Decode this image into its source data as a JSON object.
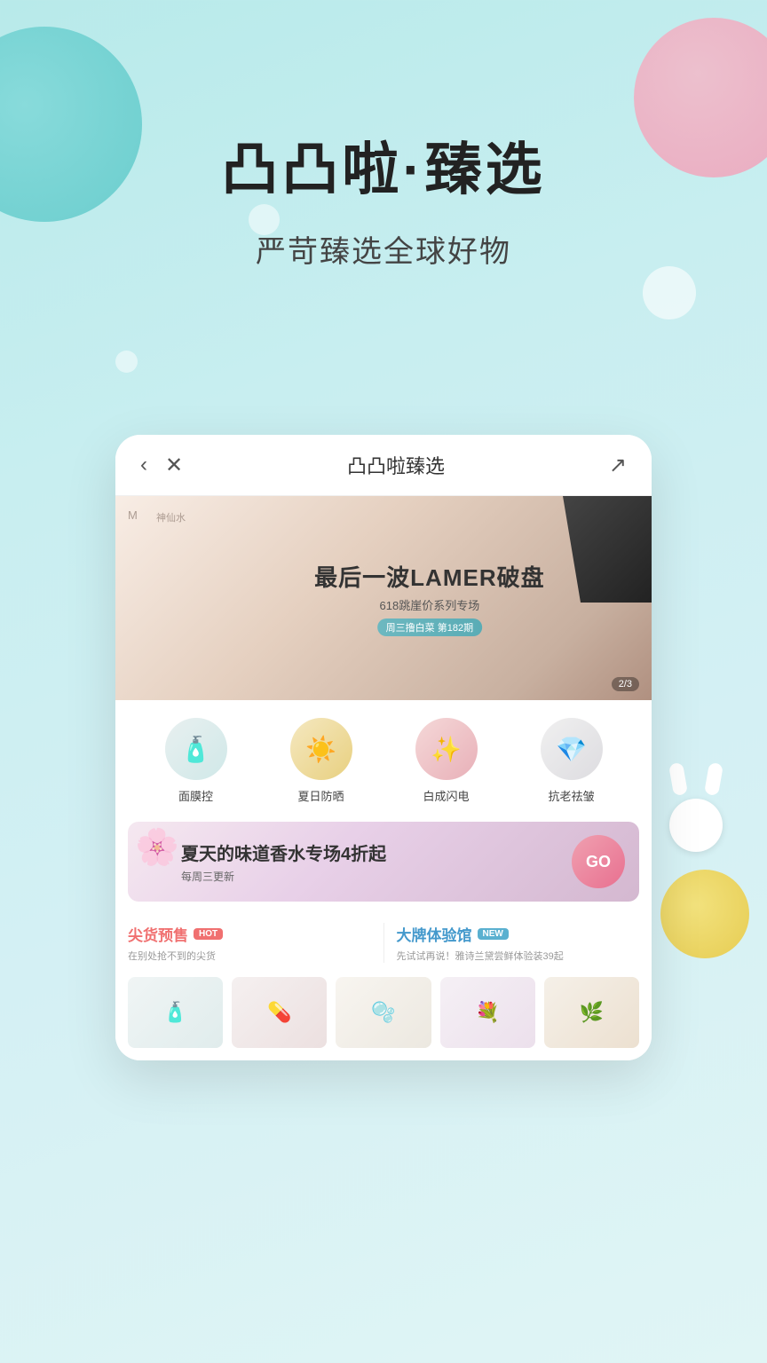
{
  "app": {
    "background_color": "#b8eaea"
  },
  "hero": {
    "title": "凸凸啦·臻选",
    "subtitle": "严苛臻选全球好物"
  },
  "phone_nav": {
    "title": "凸凸啦臻选",
    "back_label": "‹",
    "close_label": "✕",
    "share_label": "↗"
  },
  "banner": {
    "watermark": "M",
    "watermark2": "神仙水",
    "main_title": "最后一波LAMER破盘",
    "sub_title": "618跳崖价系列专场",
    "tag_label": "周三撸白菜 第182期",
    "indicator": "2/3"
  },
  "categories": [
    {
      "label": "面膜控",
      "icon": "🧴",
      "bg": "cat-1"
    },
    {
      "label": "夏日防晒",
      "icon": "☀️",
      "bg": "cat-2"
    },
    {
      "label": "白成闪电",
      "icon": "✨",
      "bg": "cat-3"
    },
    {
      "label": "抗老祛皱",
      "icon": "💎",
      "bg": "cat-4"
    }
  ],
  "promo_banner": {
    "title": "夏天的味道香水专场4折起",
    "sub": "每周三更新",
    "go_label": "GO"
  },
  "sections": {
    "left": {
      "title": "尖货预售",
      "badge": "HOT",
      "desc": "在别处抢不到的尖货"
    },
    "right": {
      "title": "大牌体验馆",
      "badge": "NEW",
      "desc": "先试试再说！雅诗兰黛尝鲜体验装39起"
    }
  },
  "products": [
    {
      "color": "thumb-1"
    },
    {
      "color": "thumb-2"
    },
    {
      "color": "thumb-3"
    },
    {
      "color": "thumb-4"
    },
    {
      "color": "thumb-5"
    }
  ]
}
